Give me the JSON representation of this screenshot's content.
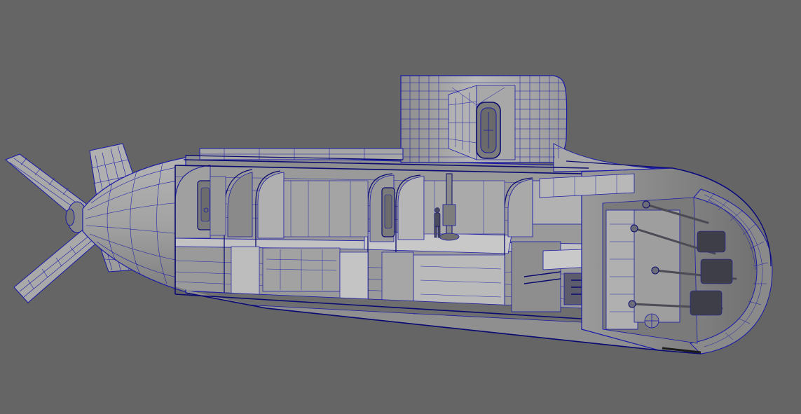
{
  "viewport": {
    "background": "#656565",
    "wire_color": "#1a1aa8",
    "wire_dark": "#0a0a70",
    "surface_light": "#b9b9b9",
    "surface_mid": "#a4a4a4",
    "surface_dark": "#8e8e8e"
  },
  "model": {
    "object": "submarine-cutaway-wireframe",
    "shading": "wireframe-on-shaded"
  }
}
